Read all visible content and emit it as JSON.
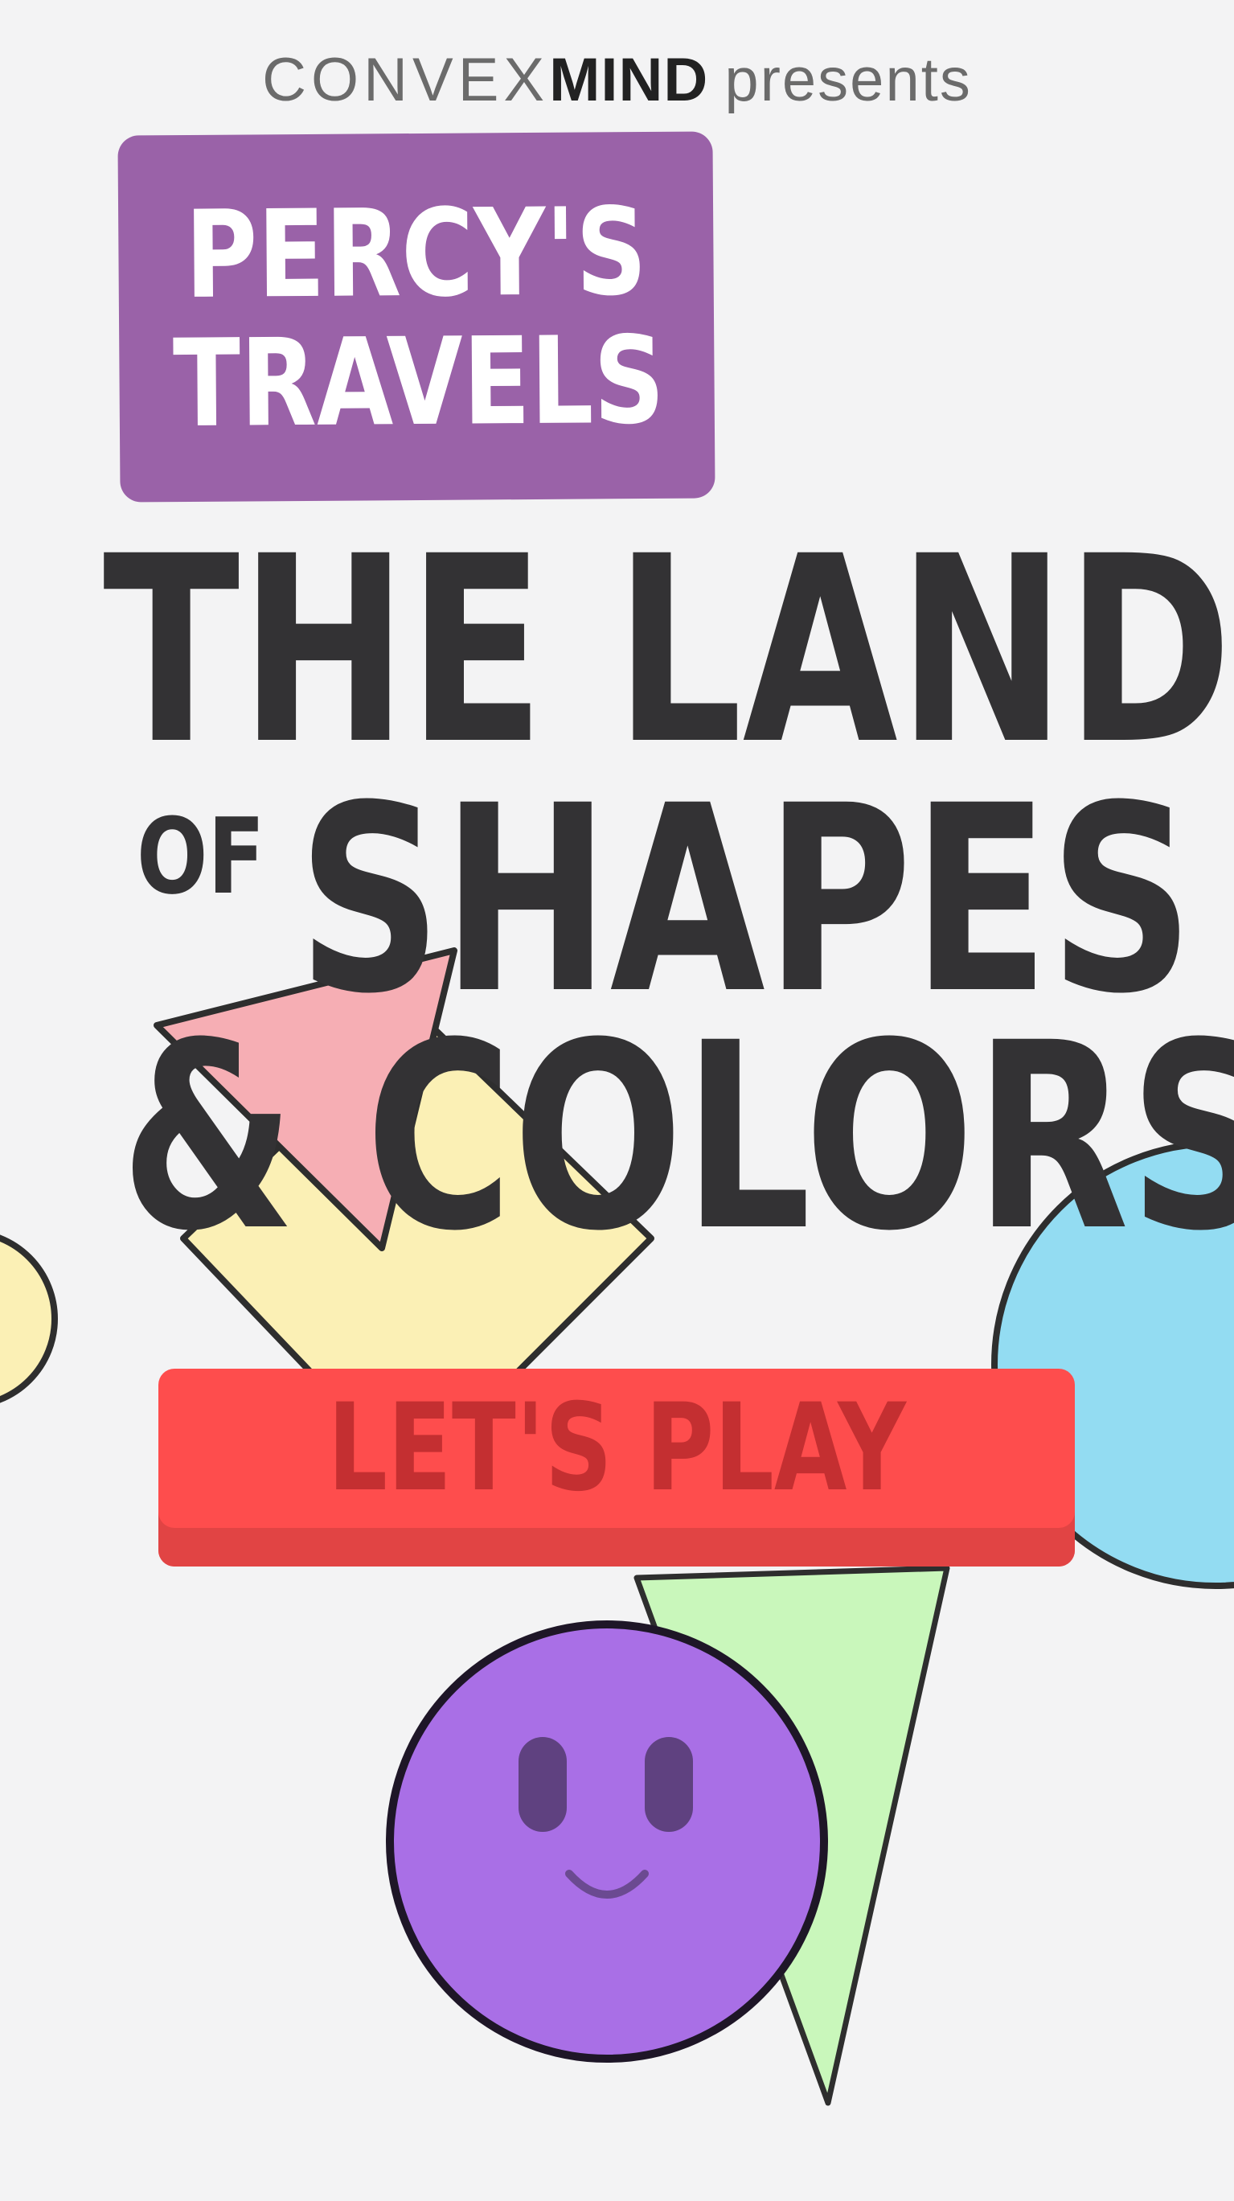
{
  "brand": {
    "company_part1": "CONVEX",
    "company_part2": "MIND",
    "presents": "presents"
  },
  "logo": {
    "line1": "PERCY'S",
    "line2": "TRAVELS",
    "color": "#9a62a8"
  },
  "title": {
    "line1": "THE LAND",
    "of": "OF",
    "line2": "SHAPES",
    "line3": "& COLORS"
  },
  "play_button": {
    "label": "LET'S PLAY",
    "color": "#fe4d4d",
    "text_color": "#c42f31"
  },
  "decorative_shapes": {
    "pink_triangle": "#f6aeb4",
    "yellow_diamond": "#fbf0b5",
    "blue_circle": "#93dcf2",
    "green_triangle": "#c9f7bb",
    "purple_character": "#a96fe6",
    "outline": "#2e2e2e"
  }
}
